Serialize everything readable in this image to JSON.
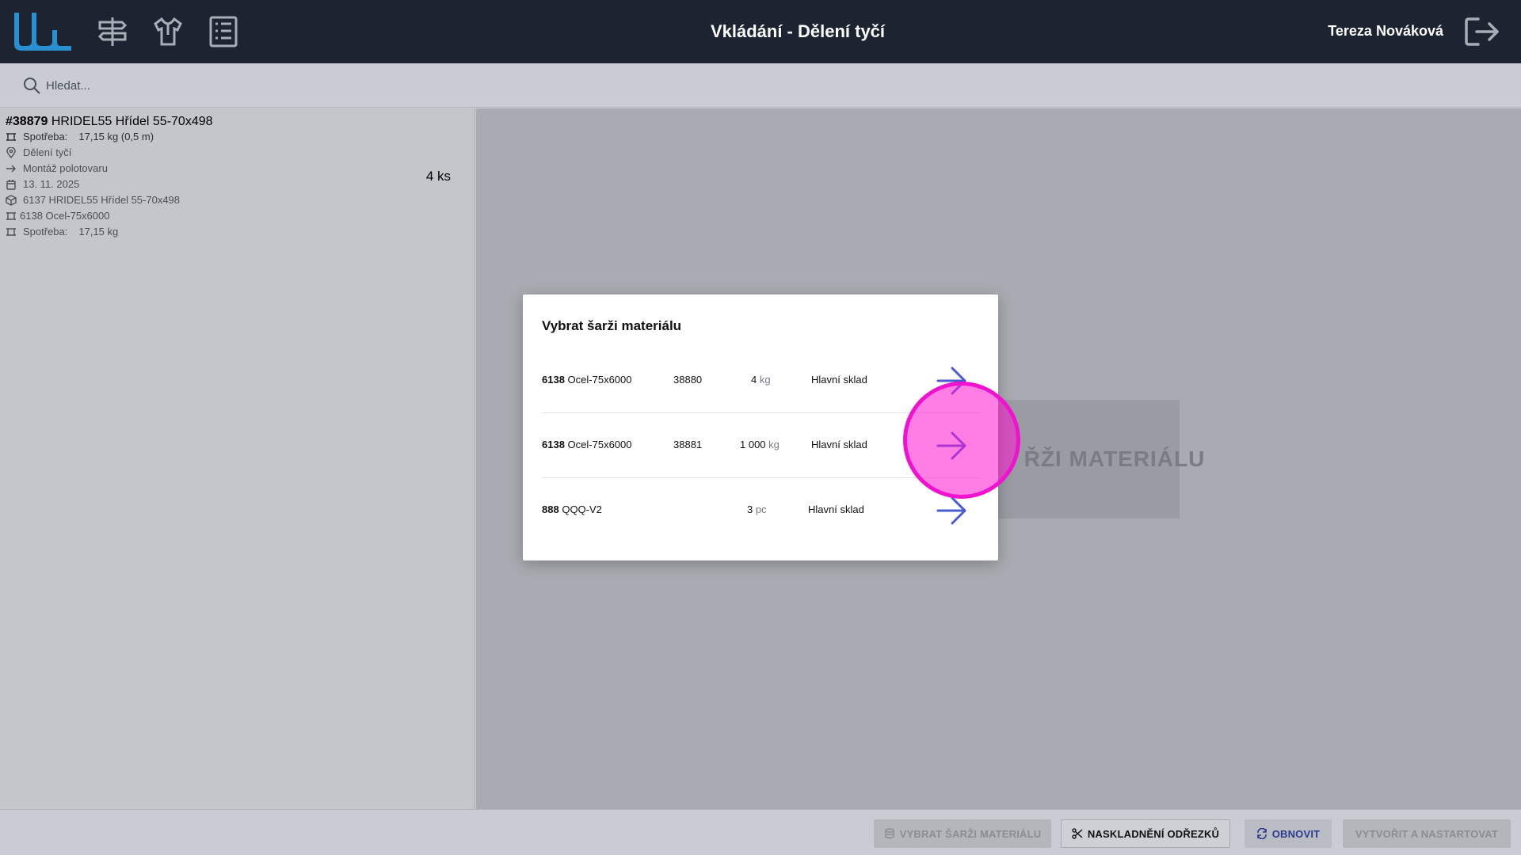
{
  "header": {
    "title": "Vkládání - Dělení tyčí",
    "user_name": "Tereza Nováková",
    "colors": {
      "background": "#1c2431",
      "logo": "#2a8fd0"
    },
    "nav_icons": [
      "logo-icon",
      "signpost-icon",
      "shirt-icon",
      "list-icon",
      "logout-icon"
    ]
  },
  "search": {
    "placeholder": "Hledat..."
  },
  "order": {
    "number": "#38879",
    "name": "HRIDEL55 Hřídel 55-70x498",
    "consumption_label": "Spotřeba:",
    "consumption_value": "17,15 kg (0,5 m)",
    "workplace": "Dělení tyčí",
    "next_step": "Montáž polotovaru",
    "date": "13. 11. 2025",
    "product": "6137 HRIDEL55 Hřídel 55-70x498",
    "material": "6138 Ocel-75x6000",
    "material_consumption_label": "Spotřeba:",
    "material_consumption_value": "17,15 kg",
    "quantity": "4 ks"
  },
  "background_card": {
    "label": "ŘŽI MATERIÁLU"
  },
  "modal": {
    "title": "Vybrat šarži materiálu",
    "rows": [
      {
        "code": "6138",
        "name": "Ocel-75x6000",
        "batch": "38880",
        "amount": "4",
        "unit": "kg",
        "warehouse": "Hlavní sklad"
      },
      {
        "code": "6138",
        "name": "Ocel-75x6000",
        "batch": "38881",
        "amount": "1 000",
        "unit": "kg",
        "warehouse": "Hlavní sklad"
      },
      {
        "code": "888",
        "name": "QQQ-V2",
        "batch": "",
        "amount": "3",
        "unit": "pc",
        "warehouse": "Hlavní sklad"
      }
    ],
    "arrow_color": "#4a5bd0"
  },
  "footer": {
    "select_batch": "VYBRAT ŠARŽI MATERIÁLU",
    "store_offcuts": "NASKLADNĚNÍ ODŘEZKŮ",
    "refresh": "OBNOVIT",
    "create_start": "VYTVOŘIT A NASTARTOVAT"
  },
  "highlight_color": "#ef12cf"
}
